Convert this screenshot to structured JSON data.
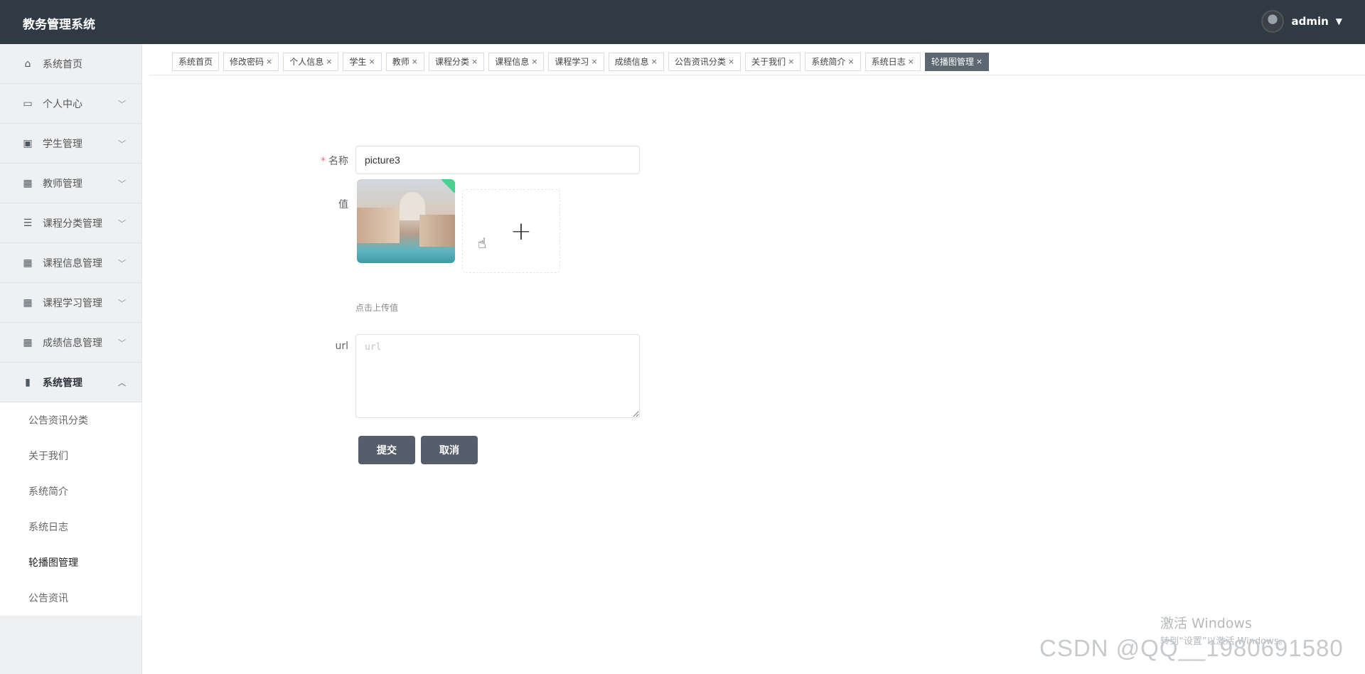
{
  "header": {
    "title": "教务管理系统",
    "user": "admin",
    "caret_icon": "caret-down-icon"
  },
  "sidebar": {
    "items": [
      {
        "label": "系统首页",
        "icon": "home-icon",
        "glyph": "⌂",
        "has_arrow": false
      },
      {
        "label": "个人中心",
        "icon": "card-icon",
        "glyph": "▭",
        "has_arrow": true
      },
      {
        "label": "学生管理",
        "icon": "clipboard-icon",
        "glyph": "▣",
        "has_arrow": true
      },
      {
        "label": "教师管理",
        "icon": "grid-icon",
        "glyph": "▦",
        "has_arrow": true
      },
      {
        "label": "课程分类管理",
        "icon": "sliders-icon",
        "glyph": "☰",
        "has_arrow": true
      },
      {
        "label": "课程信息管理",
        "icon": "grid-icon",
        "glyph": "▦",
        "has_arrow": true
      },
      {
        "label": "课程学习管理",
        "icon": "grid-icon",
        "glyph": "▦",
        "has_arrow": true
      },
      {
        "label": "成绩信息管理",
        "icon": "grid-icon",
        "glyph": "▦",
        "has_arrow": true
      },
      {
        "label": "系统管理",
        "icon": "books-icon",
        "glyph": "▮",
        "has_arrow": true,
        "open": true
      }
    ],
    "sub_items": [
      "公告资讯分类",
      "关于我们",
      "系统简介",
      "系统日志",
      "轮播图管理",
      "公告资讯"
    ],
    "active_sub": "轮播图管理"
  },
  "tabs": [
    "系统首页",
    "修改密码",
    "个人信息",
    "学生",
    "教师",
    "课程分类",
    "课程信息",
    "课程学习",
    "成绩信息",
    "公告资讯分类",
    "关于我们",
    "系统简介",
    "系统日志",
    "轮播图管理"
  ],
  "active_tab": "轮播图管理",
  "form": {
    "name_label": "名称",
    "name_value": "picture3",
    "value_label": "值",
    "upload_tip": "点击上传值",
    "url_label": "url",
    "url_placeholder": "url",
    "submit_label": "提交",
    "cancel_label": "取消"
  },
  "watermark": {
    "windows_line1": "激活 Windows",
    "windows_line2": "转到“设置”以激活 Windows。",
    "csdn": "CSDN @QQ__1980691580"
  },
  "colors": {
    "header_bg": "#2f3a44",
    "active_tab_bg": "#5c6772",
    "button_bg": "#545f6b",
    "required": "#f56c6c"
  }
}
